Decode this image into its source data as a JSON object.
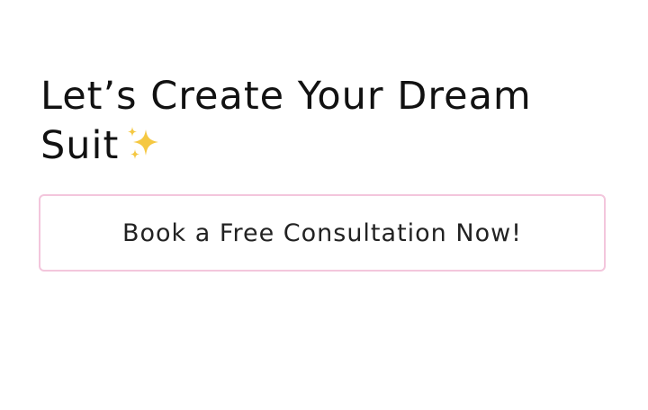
{
  "hero": {
    "heading_line1": "Let’s Create Your Dream",
    "heading_line2": "Suit",
    "sparkle_icon": "sparkles-icon",
    "sparkle_color": "#f5c842"
  },
  "cta": {
    "label": "Book a Free Consultation Now!",
    "border_color": "#f3c6dc"
  }
}
